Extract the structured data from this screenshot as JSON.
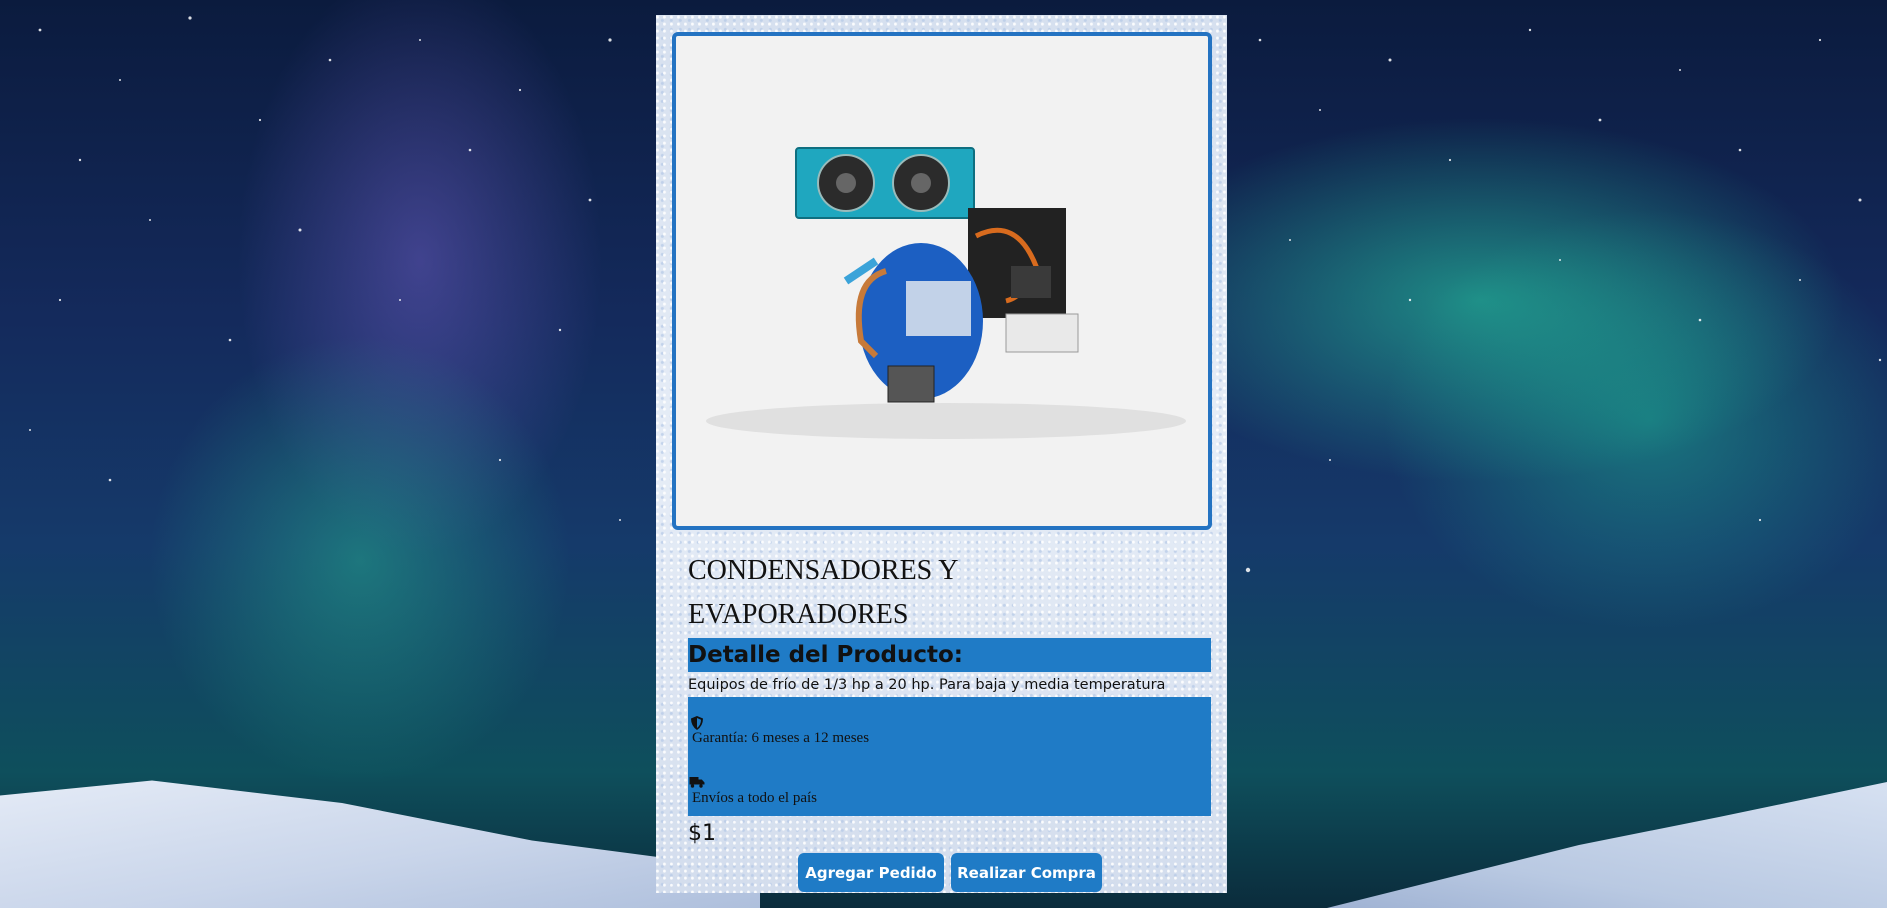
{
  "product": {
    "title_line1": "CONDENSADORES Y",
    "title_line2": "EVAPORADORES",
    "detail_heading": "Detalle del Producto:",
    "description": "Equipos de frío de 1/3 hp a 20 hp. Para baja y media temperatura",
    "features": [
      {
        "icon": "shield-icon",
        "text": "Garantía: 6 meses a 12 meses"
      },
      {
        "icon": "truck-icon",
        "text": "Envíos a todo el país"
      }
    ],
    "price": "$1"
  },
  "actions": {
    "add_order": "Agregar Pedido",
    "buy": "Realizar Compra"
  },
  "colors": {
    "accent": "#1f7bc6",
    "frame_border": "#2473c2"
  }
}
